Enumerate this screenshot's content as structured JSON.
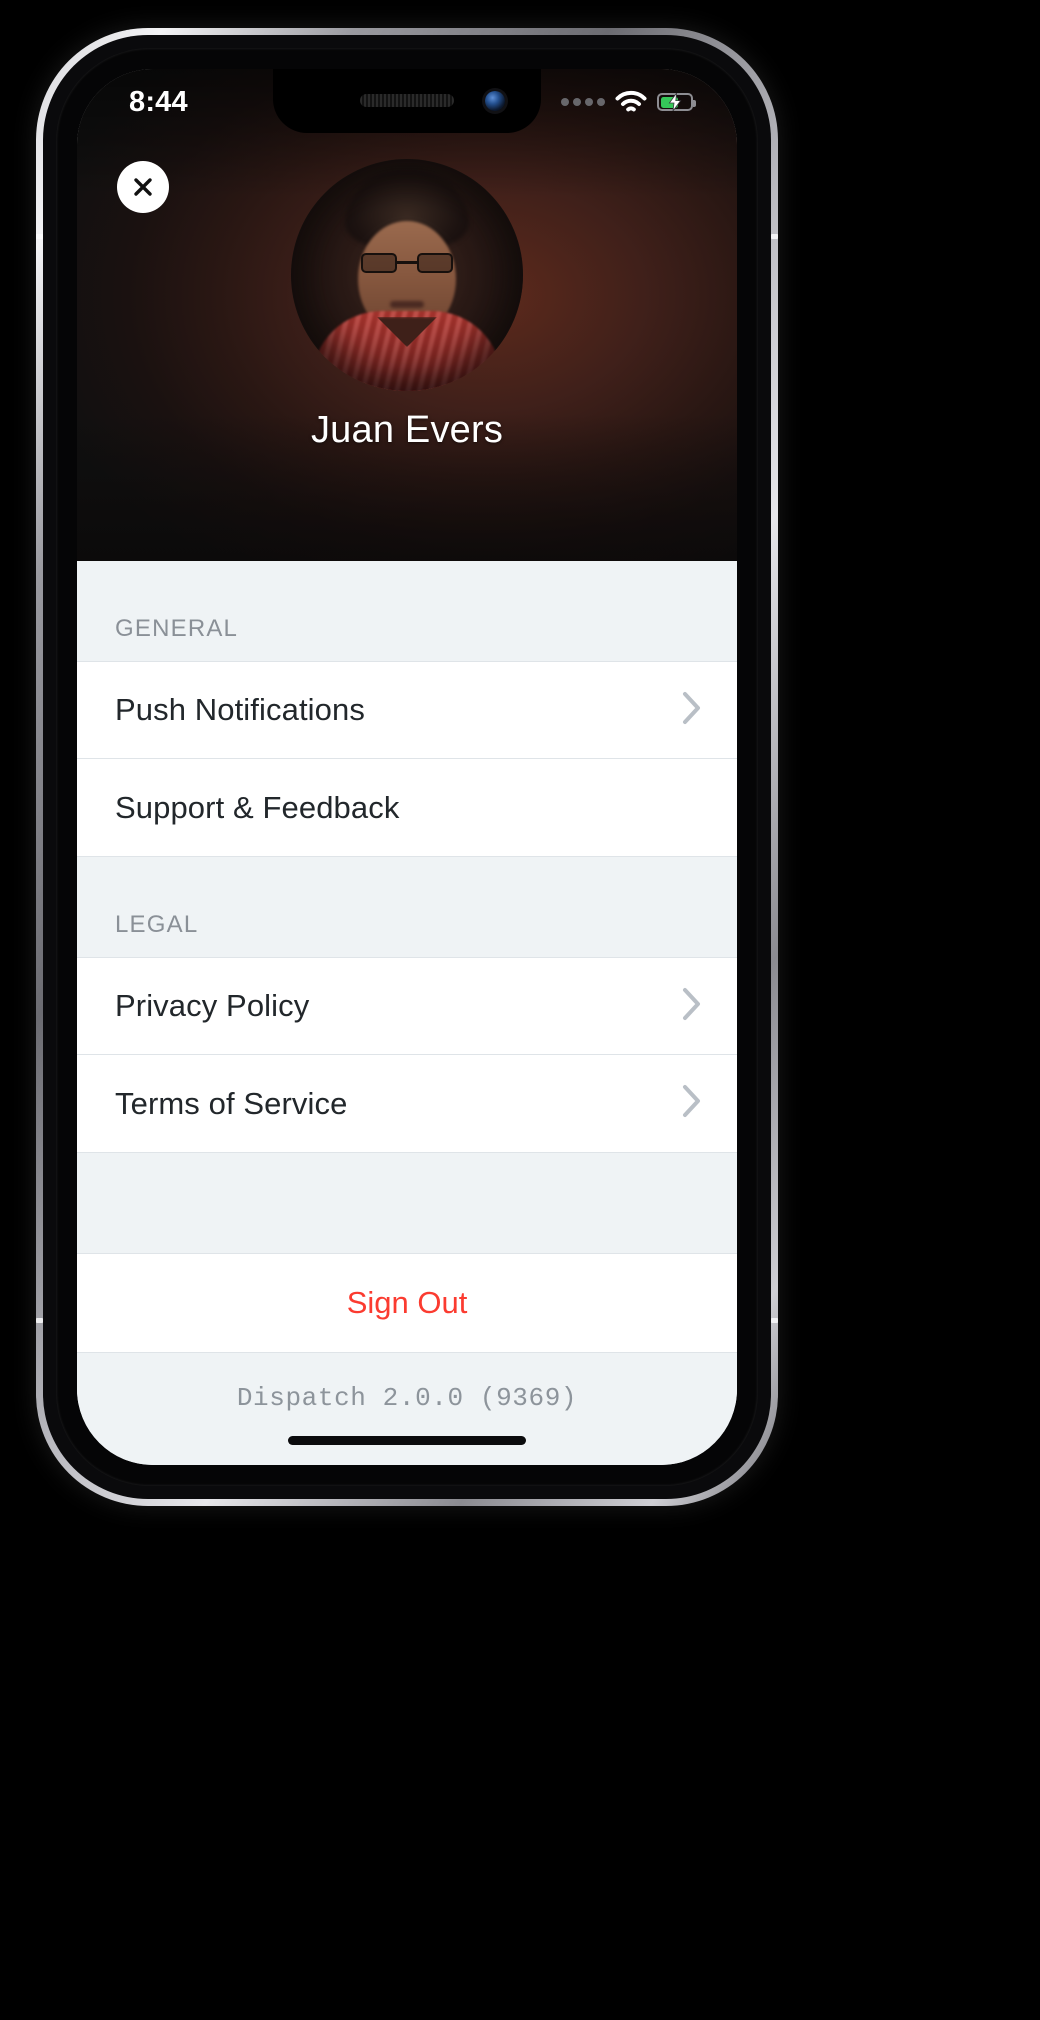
{
  "status_bar": {
    "time": "8:44",
    "signal_icon": "signal-dots-icon",
    "signal_dots": 4,
    "wifi_icon": "wifi-icon",
    "battery_icon": "battery-charging-icon",
    "battery_color": "#35c759",
    "battery_charging": true
  },
  "header": {
    "close_icon": "close-x-icon",
    "avatar_name": "avatar",
    "profile_name": "Juan Evers"
  },
  "sections": [
    {
      "title": "GENERAL",
      "rows": [
        {
          "label": "Push Notifications",
          "chevron": true
        },
        {
          "label": "Support & Feedback",
          "chevron": false
        }
      ]
    },
    {
      "title": "LEGAL",
      "rows": [
        {
          "label": "Privacy Policy",
          "chevron": true
        },
        {
          "label": "Terms of Service",
          "chevron": true
        }
      ]
    }
  ],
  "footer": {
    "sign_out_label": "Sign Out",
    "sign_out_color": "#fb3b30",
    "version_text": "Dispatch 2.0.0 (9369)"
  }
}
